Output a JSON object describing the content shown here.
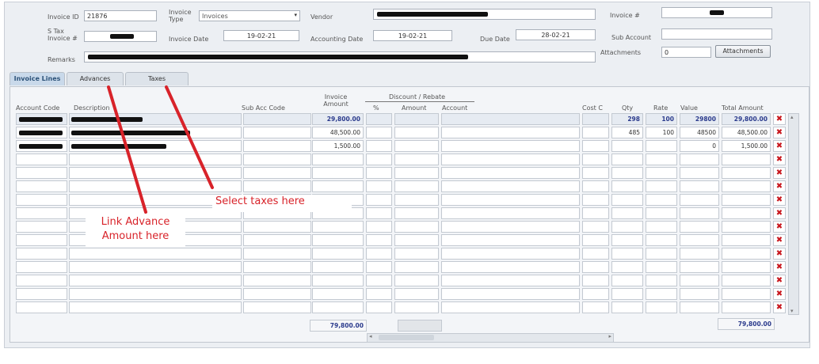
{
  "header": {
    "invoice_id_label": "Invoice ID",
    "invoice_id_value": "21876",
    "invoice_type_label": "Invoice Type",
    "invoice_type_value": "Invoices",
    "vendor_label": "Vendor",
    "invoice_no_label": "Invoice #",
    "stax_invoice_label": "S Tax Invoice #",
    "invoice_date_label": "Invoice Date",
    "invoice_date_value": "19-02-21",
    "accounting_date_label": "Accounting Date",
    "accounting_date_value": "19-02-21",
    "due_date_label": "Due Date",
    "due_date_value": "28-02-21",
    "sub_account_label": "Sub Account",
    "remarks_label": "Remarks",
    "attachments_label": "Attachments",
    "attachments_count": "0",
    "attachments_button": "Attachments"
  },
  "tabs": [
    {
      "label": "Invoice Lines",
      "active": true
    },
    {
      "label": "Advances",
      "active": false
    },
    {
      "label": "Taxes",
      "active": false
    }
  ],
  "columns": {
    "account_code": "Account Code",
    "description": "Description",
    "sub_acc_code": "Sub Acc Code",
    "invoice_amount": "Invoice Amount",
    "discount_rebate": "Discount / Rebate",
    "pct": "%",
    "amount": "Amount",
    "account": "Account",
    "cost_c": "Cost C",
    "qty": "Qty",
    "rate": "Rate",
    "value": "Value",
    "total_amount": "Total Amount"
  },
  "rows": [
    {
      "invoice_amount": "29,800.00",
      "qty": "298",
      "rate": "100",
      "value": "29800",
      "total_amount": "29,800.00",
      "highlight": true
    },
    {
      "invoice_amount": "48,500.00",
      "qty": "485",
      "rate": "100",
      "value": "48500",
      "total_amount": "48,500.00",
      "highlight": false
    },
    {
      "invoice_amount": "1,500.00",
      "qty": "",
      "rate": "",
      "value": "0",
      "total_amount": "1,500.00",
      "highlight": false
    }
  ],
  "totals": {
    "invoice_amount": "79,800.00",
    "total_amount": "79,800.00"
  },
  "annotations": {
    "advance_note_line1": "Link Advance",
    "advance_note_line2": "Amount here",
    "taxes_note": "Select taxes here"
  },
  "colors": {
    "annotation": "#d8232a",
    "delete_icon": "#c8161d",
    "highlight_text": "#2a3a8c"
  },
  "icons": {
    "delete": "delete-row-icon",
    "dropdown": "chevron-down-icon"
  }
}
